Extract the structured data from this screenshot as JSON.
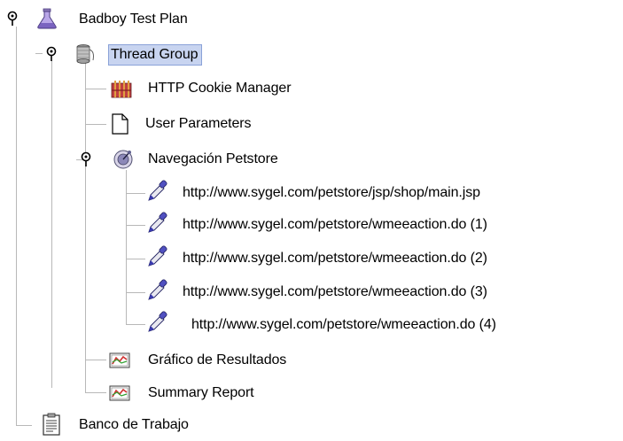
{
  "tree": {
    "root": {
      "label": "Badboy Test Plan",
      "icon": "flask-icon",
      "expanded": true
    },
    "thread_group": {
      "label": "Thread Group",
      "icon": "spool-icon",
      "expanded": true,
      "selected": true
    },
    "cookie_manager": {
      "label": "HTTP Cookie Manager",
      "icon": "cookie-manager-icon"
    },
    "user_parameters": {
      "label": "User Parameters",
      "icon": "document-icon"
    },
    "navegacion": {
      "label": "Navegación Petstore",
      "icon": "controller-icon",
      "expanded": true
    },
    "requests": [
      {
        "label": "http://www.sygel.com/petstore/jsp/shop/main.jsp",
        "icon": "pipette-icon"
      },
      {
        "label": "http://www.sygel.com/petstore/wmeeaction.do (1)",
        "icon": "pipette-icon"
      },
      {
        "label": "http://www.sygel.com/petstore/wmeeaction.do (2)",
        "icon": "pipette-icon"
      },
      {
        "label": "http://www.sygel.com/petstore/wmeeaction.do (3)",
        "icon": "pipette-icon"
      },
      {
        "label": "http://www.sygel.com/petstore/wmeeaction.do (4)",
        "icon": "pipette-icon"
      }
    ],
    "grafico": {
      "label": "Gráfico de Resultados",
      "icon": "graph-listener-icon"
    },
    "summary": {
      "label": "Summary Report",
      "icon": "graph-listener-icon"
    },
    "workbench": {
      "label": "Banco de Trabajo",
      "icon": "clipboard-icon"
    }
  },
  "colors": {
    "selection_bg": "#c8d4f0",
    "tree_lines": "#b8b8b8",
    "pipette_blue": "#3a3ab0"
  }
}
